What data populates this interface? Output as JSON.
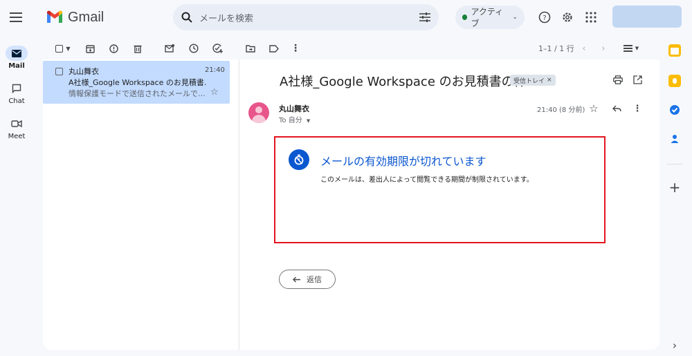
{
  "header": {
    "app_name": "Gmail",
    "search_placeholder": "メールを検索",
    "status_label": "アクティブ",
    "icons": [
      "menu-icon",
      "gmail-logo",
      "search-icon",
      "search-options-icon",
      "help-icon",
      "settings-icon",
      "apps-icon"
    ]
  },
  "rail": {
    "items": [
      {
        "label": "Mail",
        "icon": "mail-icon",
        "active": true
      },
      {
        "label": "Chat",
        "icon": "chat-icon",
        "active": false
      },
      {
        "label": "Meet",
        "icon": "meet-icon",
        "active": false
      }
    ]
  },
  "toolbar": {
    "pager": "1–1 / 1 行"
  },
  "list": {
    "rows": [
      {
        "sender": "丸山舞衣",
        "time": "21:40",
        "subject": "A社様_Google Workspace のお見積書...",
        "snippet": "情報保護モードで送信されたメールで..."
      }
    ]
  },
  "message": {
    "subject": "A社様_Google Workspace のお見積書の件",
    "label": "受信トレイ",
    "label_close": "×",
    "from": "丸山舞衣",
    "to": "To 自分",
    "time": "21:40 (8 分前)",
    "notice_title": "メールの有効期限が切れています",
    "notice_body": "このメールは、差出人によって閲覧できる期間が制限されています。",
    "reply_label": "返信"
  },
  "colors": {
    "accent": "#0b57d0",
    "selected_row": "#c2dbff",
    "highlight_border": "#e2141f",
    "status_active": "#188038"
  }
}
